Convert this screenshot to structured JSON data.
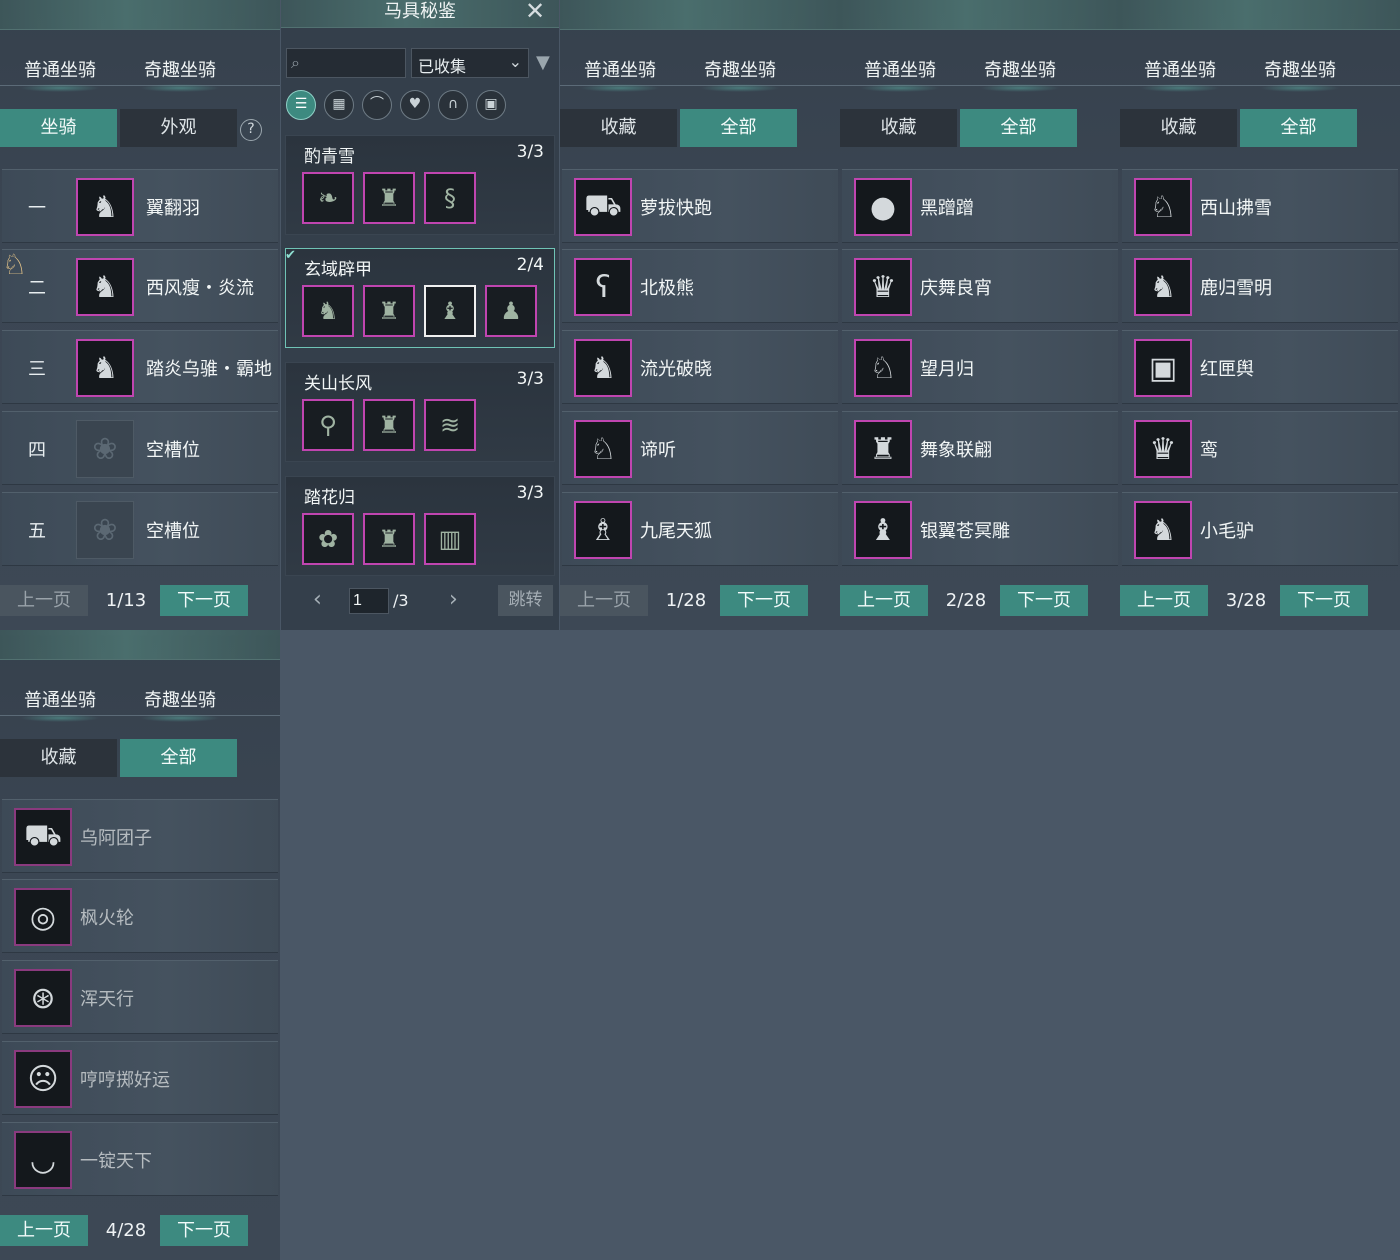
{
  "common": {
    "tab_normal": "普通坐骑",
    "tab_fun": "奇趣坐骑",
    "prev": "上一页",
    "next": "下一页",
    "sub_fav": "收藏",
    "sub_all": "全部"
  },
  "panel1": {
    "sub_mount": "坐骑",
    "sub_look": "外观",
    "help": "?",
    "rows": [
      {
        "idx": "一",
        "name": "翼翻羽"
      },
      {
        "idx": "二",
        "name": "西风瘦・炎流"
      },
      {
        "idx": "三",
        "name": "踏炎乌骓・霸地"
      },
      {
        "idx": "四",
        "name": "空槽位"
      },
      {
        "idx": "五",
        "name": "空槽位"
      }
    ],
    "page": "1/13"
  },
  "mid": {
    "title": "马具秘鉴",
    "close": "✕",
    "search_placeholder": "",
    "filter_value": "已收集",
    "sets": [
      {
        "name": "酌青雪",
        "count": "3/3"
      },
      {
        "name": "玄域辟甲",
        "count": "2/4"
      },
      {
        "name": "关山长风",
        "count": "3/3"
      },
      {
        "name": "踏花归",
        "count": "3/3"
      }
    ],
    "page_input": "1",
    "page_total": "/3",
    "jump": "跳转"
  },
  "panel3": {
    "rows": [
      "萝拔快跑",
      "北极熊",
      "流光破晓",
      "谛听",
      "九尾天狐"
    ],
    "page": "1/28"
  },
  "panel4": {
    "rows": [
      "黑蹭蹭",
      "庆舞良宵",
      "望月归",
      "舞象联翩",
      "银翼苍冥雕"
    ],
    "page": "2/28"
  },
  "panel5": {
    "rows": [
      "西山拂雪",
      "鹿归雪明",
      "红匣舆",
      "鸾",
      "小毛驴"
    ],
    "page": "3/28"
  },
  "panel6": {
    "rows": [
      "乌阿团子",
      "枫火轮",
      "浑天行",
      "哼哼掷好运",
      "一锭天下"
    ],
    "page": "4/28"
  }
}
